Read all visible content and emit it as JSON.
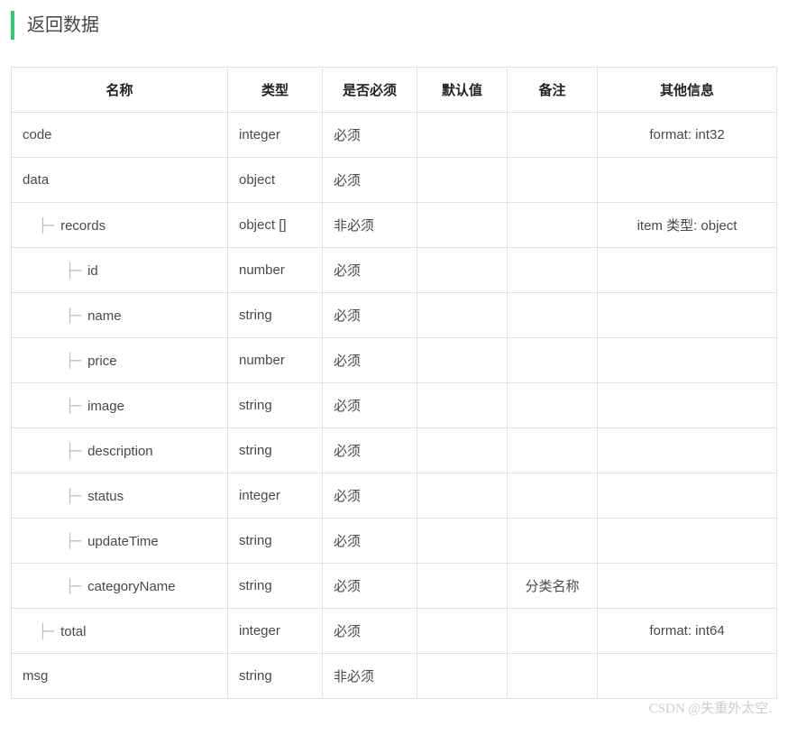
{
  "section_title": "返回数据",
  "tree_marker": "├─ ",
  "headers": {
    "name": "名称",
    "type": "类型",
    "required": "是否必须",
    "default": "默认值",
    "remark": "备注",
    "other": "其他信息"
  },
  "rows": [
    {
      "name": "code",
      "indent": 0,
      "type": "integer",
      "required": "必须",
      "default": "",
      "remark": "",
      "other": "format: int32"
    },
    {
      "name": "data",
      "indent": 0,
      "type": "object",
      "required": "必须",
      "default": "",
      "remark": "",
      "other": ""
    },
    {
      "name": "records",
      "indent": 1,
      "type": "object []",
      "required": "非必须",
      "default": "",
      "remark": "",
      "other": "item 类型: object"
    },
    {
      "name": "id",
      "indent": 2,
      "type": "number",
      "required": "必须",
      "default": "",
      "remark": "",
      "other": ""
    },
    {
      "name": "name",
      "indent": 2,
      "type": "string",
      "required": "必须",
      "default": "",
      "remark": "",
      "other": ""
    },
    {
      "name": "price",
      "indent": 2,
      "type": "number",
      "required": "必须",
      "default": "",
      "remark": "",
      "other": ""
    },
    {
      "name": "image",
      "indent": 2,
      "type": "string",
      "required": "必须",
      "default": "",
      "remark": "",
      "other": ""
    },
    {
      "name": "description",
      "indent": 2,
      "type": "string",
      "required": "必须",
      "default": "",
      "remark": "",
      "other": ""
    },
    {
      "name": "status",
      "indent": 2,
      "type": "integer",
      "required": "必须",
      "default": "",
      "remark": "",
      "other": ""
    },
    {
      "name": "updateTime",
      "indent": 2,
      "type": "string",
      "required": "必须",
      "default": "",
      "remark": "",
      "other": ""
    },
    {
      "name": "categoryName",
      "indent": 2,
      "type": "string",
      "required": "必须",
      "default": "",
      "remark": "分类名称",
      "other": ""
    },
    {
      "name": "total",
      "indent": 1,
      "type": "integer",
      "required": "必须",
      "default": "",
      "remark": "",
      "other": "format: int64"
    },
    {
      "name": "msg",
      "indent": 0,
      "type": "string",
      "required": "非必须",
      "default": "",
      "remark": "",
      "other": ""
    }
  ],
  "watermark": "CSDN @失重外太空."
}
